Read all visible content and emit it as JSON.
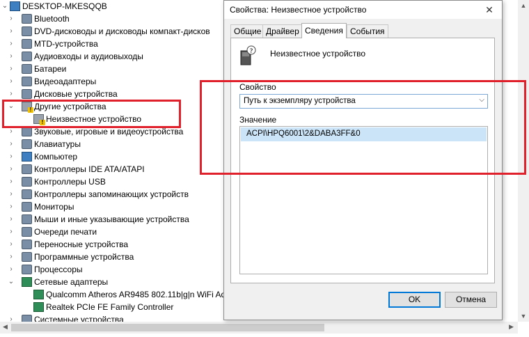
{
  "tree": {
    "root": "DESKTOP-MKESQQB",
    "items": [
      {
        "label": "Bluetooth",
        "icon": "bluetooth-icon",
        "state": "collapsed"
      },
      {
        "label": "DVD-дисководы и дисководы компакт-дисков",
        "icon": "dvd-drive-icon",
        "state": "collapsed"
      },
      {
        "label": "MTD-устройства",
        "icon": "mtd-device-icon",
        "state": "collapsed"
      },
      {
        "label": "Аудиовходы и аудиовыходы",
        "icon": "speaker-icon",
        "state": "collapsed"
      },
      {
        "label": "Батареи",
        "icon": "battery-icon",
        "state": "collapsed"
      },
      {
        "label": "Видеоадаптеры",
        "icon": "display-adapter-icon",
        "state": "collapsed"
      },
      {
        "label": "Дисковые устройства",
        "icon": "disk-drive-icon",
        "state": "collapsed"
      },
      {
        "label": "Другие устройства",
        "icon": "other-devices-icon",
        "state": "expanded"
      },
      {
        "label": "Неизвестное устройство",
        "icon": "unknown-device-warning-icon",
        "state": "child"
      },
      {
        "label": "Звуковые, игровые и видеоустройства",
        "icon": "sound-device-icon",
        "state": "collapsed"
      },
      {
        "label": "Клавиатуры",
        "icon": "keyboard-icon",
        "state": "collapsed"
      },
      {
        "label": "Компьютер",
        "icon": "computer-icon",
        "state": "collapsed"
      },
      {
        "label": "Контроллеры IDE ATA/ATAPI",
        "icon": "ide-controller-icon",
        "state": "collapsed"
      },
      {
        "label": "Контроллеры USB",
        "icon": "usb-controller-icon",
        "state": "collapsed"
      },
      {
        "label": "Контроллеры запоминающих устройств",
        "icon": "storage-controller-icon",
        "state": "collapsed"
      },
      {
        "label": "Мониторы",
        "icon": "monitor-icon",
        "state": "collapsed"
      },
      {
        "label": "Мыши и иные указывающие устройства",
        "icon": "mouse-icon",
        "state": "collapsed"
      },
      {
        "label": "Очереди печати",
        "icon": "printer-icon",
        "state": "collapsed"
      },
      {
        "label": "Переносные устройства",
        "icon": "portable-device-icon",
        "state": "collapsed"
      },
      {
        "label": "Программные устройства",
        "icon": "software-device-icon",
        "state": "collapsed"
      },
      {
        "label": "Процессоры",
        "icon": "processor-icon",
        "state": "collapsed"
      },
      {
        "label": "Сетевые адаптеры",
        "icon": "network-adapter-icon",
        "state": "expanded"
      },
      {
        "label": "Qualcomm Atheros AR9485 802.11b|g|n WiFi Ad",
        "icon": "network-card-icon",
        "state": "child"
      },
      {
        "label": "Realtek PCIe FE Family Controller",
        "icon": "network-card-icon",
        "state": "child"
      },
      {
        "label": "Системные устройства",
        "icon": "system-device-icon",
        "state": "collapsed"
      }
    ]
  },
  "dialog": {
    "title": "Свойства: Неизвестное устройство",
    "tabs": [
      "Общие",
      "Драйвер",
      "Сведения",
      "События"
    ],
    "active_tab": "Сведения",
    "device_name": "Неизвестное устройство",
    "property_label": "Свойство",
    "property_value": "Путь к экземпляру устройства",
    "value_label": "Значение",
    "value_text": "ACPI\\HPQ6001\\2&DABA3FF&0",
    "ok_label": "OK",
    "cancel_label": "Отмена"
  },
  "colors": {
    "highlight": "#e0202a",
    "selection": "#cce4f7",
    "accent": "#0078d7"
  }
}
